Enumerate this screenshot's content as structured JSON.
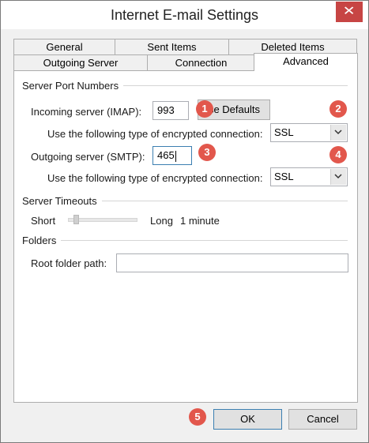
{
  "window": {
    "title": "Internet E-mail Settings",
    "close_glyph": "✕"
  },
  "tabs": {
    "row1": [
      "General",
      "Sent Items",
      "Deleted Items"
    ],
    "row2": [
      "Outgoing Server",
      "Connection",
      "Advanced"
    ],
    "active": "Advanced"
  },
  "server_ports": {
    "section_label": "Server Port Numbers",
    "incoming_label": "Incoming server (IMAP):",
    "incoming_value": "993",
    "use_defaults_label": "se Defaults",
    "incoming_encryption_label": "Use the following type of encrypted connection:",
    "incoming_encryption_value": "SSL",
    "outgoing_label": "Outgoing server (SMTP):",
    "outgoing_value": "465",
    "outgoing_encryption_label": "Use the following type of encrypted connection:",
    "outgoing_encryption_value": "SSL"
  },
  "timeouts": {
    "section_label": "Server Timeouts",
    "short_label": "Short",
    "long_label": "Long",
    "value_label": "1 minute",
    "slider_level": 0.08
  },
  "folders": {
    "section_label": "Folders",
    "root_label": "Root folder path:",
    "root_value": ""
  },
  "footer": {
    "ok_label": "OK",
    "cancel_label": "Cancel"
  },
  "badges": [
    "1",
    "2",
    "3",
    "4",
    "5"
  ],
  "colors": {
    "badge": "#e2574c",
    "close_button": "#c74544",
    "focus_border": "#3c7fb1"
  }
}
